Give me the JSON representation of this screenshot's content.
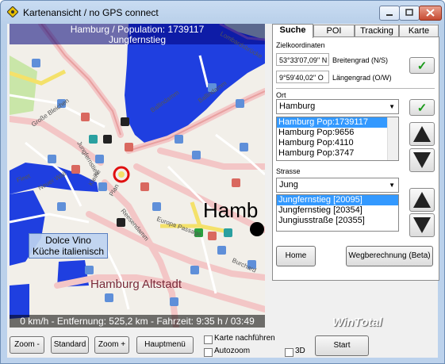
{
  "window": {
    "title": "Kartenansicht / no GPS connect"
  },
  "map": {
    "header_line1": "Hamburg / Population: 1739117",
    "header_line2": "Jungfernstieg",
    "status": "0 km/h - Entfernung: 525,2 km - Fahrzeit: 9:35 h / 03:49",
    "poi_label_line1": "Dolce Vino",
    "poi_label_line2": "Küche italienisch",
    "city_label": "Hamb",
    "district_label": "Hamburg Altstadt",
    "watermark": "WinTotal",
    "street_labels": [
      "Große Bleichen",
      "Neuer Wall",
      "Ballindamm",
      "Ballindamm",
      "Plan",
      "Europa Passage",
      "Burchard",
      "Lombardsbrücke",
      "Jungfernstieg",
      "Kleine",
      "Fleet",
      "Reesendamm"
    ]
  },
  "tabs": [
    "Suche",
    "POI",
    "Tracking",
    "Karte"
  ],
  "search": {
    "coords_title": "Zielkoordinaten",
    "lat_value": "53°33'07,09'' N",
    "lat_label": "Breitengrad (N/S)",
    "lon_value": "9°59'40,02'' O",
    "lon_label": "Längengrad (O/W)",
    "ok_glyph": "✓",
    "ort_title": "Ort",
    "ort_value": "Hamburg",
    "ort_list": [
      "Hamburg  Pop:1739117",
      "Hamburg  Pop:9656",
      "Hamburg  Pop:4110",
      "Hamburg  Pop:3747"
    ],
    "strasse_title": "Strasse",
    "strasse_value": "Jung",
    "strasse_list": [
      "Jungfernstieg [20095]",
      "Jungfernstieg [20354]",
      "Jungiusstraße [20355]"
    ],
    "home_button": "Home",
    "route_button": "Wegberechnung (Beta)"
  },
  "toolbar": {
    "zoom_minus": "Zoom -",
    "standard": "Standard",
    "zoom_plus": "Zoom +",
    "main_menu": "Hauptmenü",
    "follow_map": "Karte nachführen",
    "autozoom": "Autozoom",
    "three_d": "3D",
    "start": "Start"
  },
  "colors": {
    "water": "#1f3fe0",
    "accent_green": "#1a9a1a",
    "selection": "#3399ff",
    "road_main": "#f3c6c6"
  }
}
